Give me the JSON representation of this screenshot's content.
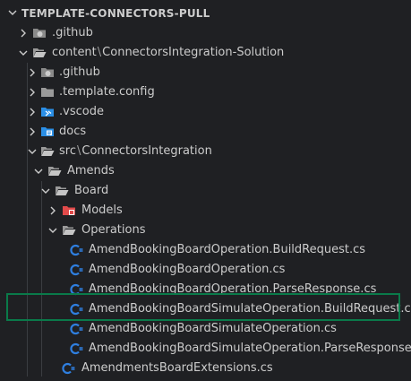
{
  "explorer": {
    "section_title": "TEMPLATE-CONNECTORS-PULL",
    "items": [
      {
        "label": ".github",
        "type": "folder-github",
        "expanded": false
      },
      {
        "label": "content",
        "label_suffix": "ConnectorsIntegration-Solution",
        "type": "folder",
        "expanded": true
      },
      {
        "label": ".github",
        "type": "folder-github",
        "expanded": false
      },
      {
        "label": ".template.config",
        "type": "folder",
        "expanded": false
      },
      {
        "label": ".vscode",
        "type": "folder-vscode",
        "expanded": false
      },
      {
        "label": "docs",
        "type": "folder-docs",
        "expanded": false
      },
      {
        "label": "src",
        "label_suffix": "ConnectorsIntegration",
        "type": "folder",
        "expanded": true
      },
      {
        "label": "Amends",
        "type": "folder",
        "expanded": true
      },
      {
        "label": "Board",
        "type": "folder",
        "expanded": true
      },
      {
        "label": "Models",
        "type": "folder-models",
        "expanded": false
      },
      {
        "label": "Operations",
        "type": "folder",
        "expanded": true
      },
      {
        "label": "AmendBookingBoardOperation.BuildRequest.cs",
        "type": "csharp-file"
      },
      {
        "label": "AmendBookingBoardOperation.cs",
        "type": "csharp-file"
      },
      {
        "label": "AmendBookingBoardOperation.ParseResponse.cs",
        "type": "csharp-file"
      },
      {
        "label": "AmendBookingBoardSimulateOperation.BuildRequest.cs",
        "type": "csharp-file",
        "highlighted": true
      },
      {
        "label": "AmendBookingBoardSimulateOperation.cs",
        "type": "csharp-file"
      },
      {
        "label": "AmendBookingBoardSimulateOperation.ParseResponse.cs",
        "type": "csharp-file"
      },
      {
        "label": "AmendmentsBoardExtensions.cs",
        "type": "csharp-file"
      }
    ]
  },
  "colors": {
    "background": "#1f2023",
    "text": "#cccccc",
    "folder": "#c5c5c5",
    "csharp": "#2f7fe0",
    "highlight_border": "#0a7a4a",
    "vscode_blue": "#2b8fe6",
    "models_red": "#e14a4a"
  }
}
